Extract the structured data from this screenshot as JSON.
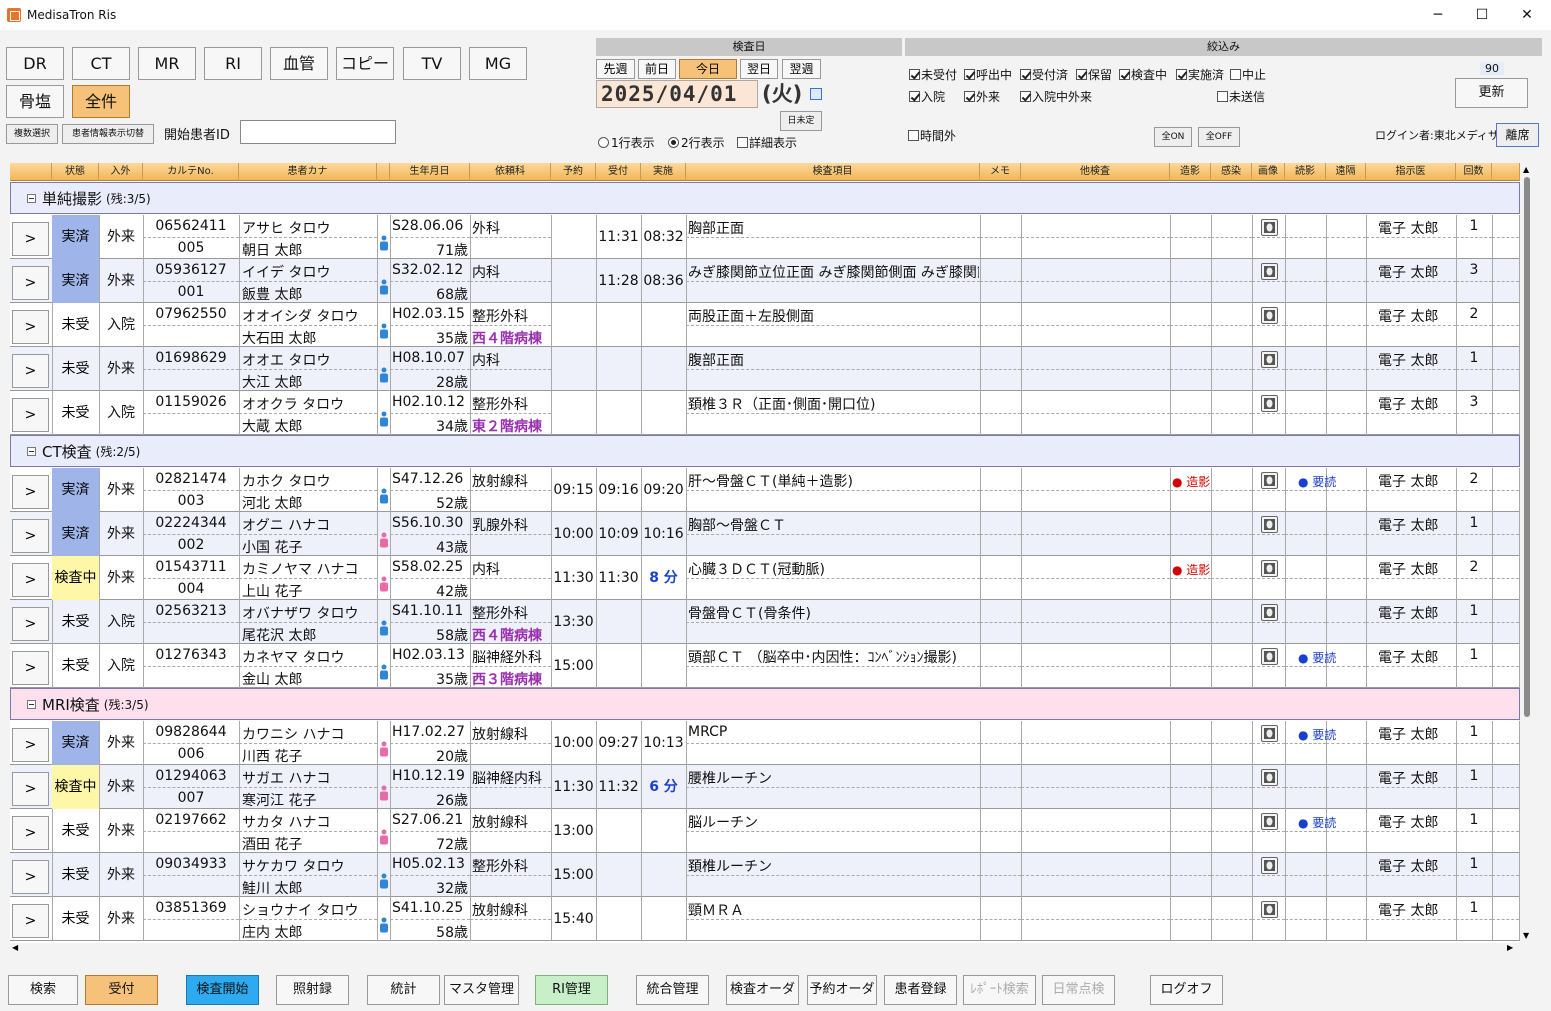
{
  "window": {
    "title": "MedisaTron Ris",
    "min": "─",
    "max": "☐",
    "close": "✕"
  },
  "modalities": [
    "DR",
    "CT",
    "MR",
    "RI",
    "血管",
    "コピー",
    "TV",
    "MG",
    "骨塩",
    "全件"
  ],
  "toolbar": {
    "multi_select": "複数選択",
    "patient_info_toggle": "患者情報表示切替",
    "start_patient_label": "開始患者ID",
    "start_patient_value": ""
  },
  "date": {
    "header": "検査日",
    "prev_week": "先週",
    "prev_day": "前日",
    "today": "今日",
    "next_day": "翌日",
    "next_week": "翌週",
    "value": "2025/04/01",
    "weekday": "(火)",
    "undetermined": "日未定",
    "display": {
      "one_line": "1行表示",
      "two_line": "2行表示",
      "detail": "詳細表示"
    }
  },
  "filter": {
    "header": "絞込み",
    "status": [
      {
        "label": "未受付",
        "on": true
      },
      {
        "label": "呼出中",
        "on": true
      },
      {
        "label": "受付済",
        "on": true
      },
      {
        "label": "保留",
        "on": true
      },
      {
        "label": "検査中",
        "on": true
      },
      {
        "label": "実施済",
        "on": true
      },
      {
        "label": "中止",
        "on": false
      }
    ],
    "types": [
      {
        "label": "入院",
        "on": true
      },
      {
        "label": "外来",
        "on": true
      },
      {
        "label": "入院中外来",
        "on": true
      }
    ],
    "unsent": {
      "label": "未送信",
      "on": false
    },
    "after_hours": {
      "label": "時間外",
      "on": false
    },
    "all_on": "全ON",
    "all_off": "全OFF",
    "count": "90",
    "refresh": "更新",
    "login": "ログイン者:東北メディサ",
    "leave": "離席"
  },
  "columns": [
    "状態",
    "入外",
    "カルテNo.",
    "患者カナ",
    "生年月日",
    "依頼科",
    "予約",
    "受付",
    "実施",
    "検査項目",
    "メモ",
    "他検査",
    "造影",
    "感染",
    "画像",
    "読影",
    "遠隔",
    "指示医",
    "回数"
  ],
  "groups": [
    {
      "title": "単純撮影",
      "remain": "(残:3/5)",
      "rows": [
        {
          "status": "実済",
          "type": "外来",
          "karte": "06562411",
          "sub": "005",
          "kana": "アサヒ タロウ",
          "name": "朝日 太郎",
          "sex": "M",
          "birth": "S28.06.06",
          "age": "71歳",
          "dept": "外科",
          "ward": "",
          "resv": "",
          "recv": "11:31",
          "done": "08:32",
          "item": "胸部正面",
          "contrast": "",
          "read": "",
          "doctor": "電子 太郎",
          "count": "1"
        },
        {
          "status": "実済",
          "type": "外来",
          "karte": "05936127",
          "sub": "001",
          "kana": "イイデ タロウ",
          "name": "飯豊 太郎",
          "sex": "M",
          "birth": "S32.02.12",
          "age": "68歳",
          "dept": "内科",
          "ward": "",
          "resv": "",
          "recv": "11:28",
          "done": "08:36",
          "item": "みぎ膝関節立位正面 みぎ膝関節側面 みぎ膝関節",
          "contrast": "",
          "read": "",
          "doctor": "電子 太郎",
          "count": "3"
        },
        {
          "status": "未受",
          "type": "入院",
          "karte": "07962550",
          "sub": "",
          "kana": "オオイシダ タロウ",
          "name": "大石田 太郎",
          "sex": "M",
          "birth": "H02.03.15",
          "age": "35歳",
          "dept": "整形外科",
          "ward": "西４階病棟",
          "resv": "",
          "recv": "",
          "done": "",
          "item": "両股正面＋左股側面",
          "contrast": "",
          "read": "",
          "doctor": "電子 太郎",
          "count": "2"
        },
        {
          "status": "未受",
          "type": "外来",
          "karte": "01698629",
          "sub": "",
          "kana": "オオエ タロウ",
          "name": "大江 太郎",
          "sex": "M",
          "birth": "H08.10.07",
          "age": "28歳",
          "dept": "内科",
          "ward": "",
          "resv": "",
          "recv": "",
          "done": "",
          "item": "腹部正面",
          "contrast": "",
          "read": "",
          "doctor": "電子 太郎",
          "count": "1"
        },
        {
          "status": "未受",
          "type": "入院",
          "karte": "01159026",
          "sub": "",
          "kana": "オオクラ タロウ",
          "name": "大蔵 太郎",
          "sex": "M",
          "birth": "H02.10.12",
          "age": "34歳",
          "dept": "整形外科",
          "ward": "東２階病棟",
          "resv": "",
          "recv": "",
          "done": "",
          "item": "頚椎３Ｒ（正面･側面･開口位)",
          "contrast": "",
          "read": "",
          "doctor": "電子 太郎",
          "count": "3"
        }
      ]
    },
    {
      "title": "CT検査",
      "remain": "(残:2/5)",
      "rows": [
        {
          "status": "実済",
          "type": "外来",
          "karte": "02821474",
          "sub": "003",
          "kana": "カホク タロウ",
          "name": "河北 太郎",
          "sex": "M",
          "birth": "S47.12.26",
          "age": "52歳",
          "dept": "放射線科",
          "ward": "",
          "resv": "09:15",
          "recv": "09:16",
          "done": "09:20",
          "item": "肝～骨盤ＣＴ(単純＋造影)",
          "contrast": "● 造影",
          "read": "● 要読",
          "doctor": "電子 太郎",
          "count": "2"
        },
        {
          "status": "実済",
          "type": "外来",
          "karte": "02224344",
          "sub": "002",
          "kana": "オグニ ハナコ",
          "name": "小国 花子",
          "sex": "F",
          "birth": "S56.10.30",
          "age": "43歳",
          "dept": "乳腺外科",
          "ward": "",
          "resv": "10:00",
          "recv": "10:09",
          "done": "10:16",
          "item": "胸部～骨盤ＣＴ",
          "contrast": "",
          "read": "",
          "doctor": "電子 太郎",
          "count": "1"
        },
        {
          "status": "検査中",
          "type": "外来",
          "karte": "01543711",
          "sub": "004",
          "kana": "カミノヤマ ハナコ",
          "name": "上山 花子",
          "sex": "F",
          "birth": "S58.02.25",
          "age": "42歳",
          "dept": "内科",
          "ward": "",
          "resv": "11:30",
          "recv": "11:30",
          "done": "8 分",
          "item": "心臓３ＤＣＴ(冠動脈)",
          "contrast": "● 造影",
          "read": "",
          "doctor": "電子 太郎",
          "count": "2"
        },
        {
          "status": "未受",
          "type": "入院",
          "karte": "02563213",
          "sub": "",
          "kana": "オバナザワ タロウ",
          "name": "尾花沢 太郎",
          "sex": "M",
          "birth": "S41.10.11",
          "age": "58歳",
          "dept": "整形外科",
          "ward": "西４階病棟",
          "resv": "13:30",
          "recv": "",
          "done": "",
          "item": "骨盤骨ＣＴ(骨条件)",
          "contrast": "",
          "read": "",
          "doctor": "電子 太郎",
          "count": "1"
        },
        {
          "status": "未受",
          "type": "入院",
          "karte": "01276343",
          "sub": "",
          "kana": "カネヤマ タロウ",
          "name": "金山 太郎",
          "sex": "M",
          "birth": "H02.03.13",
          "age": "35歳",
          "dept": "脳神経外科",
          "ward": "西３階病棟",
          "resv": "15:00",
          "recv": "",
          "done": "",
          "item": "頭部ＣＴ （脳卒中･内因性：ｺﾝﾍﾞﾝｼｮﾝ撮影)",
          "contrast": "",
          "read": "● 要読",
          "doctor": "電子 太郎",
          "count": "1"
        }
      ]
    },
    {
      "title": "MRI検査",
      "remain": "(残:3/5)",
      "rows": [
        {
          "status": "実済",
          "type": "外来",
          "karte": "09828644",
          "sub": "006",
          "kana": "カワニシ ハナコ",
          "name": "川西 花子",
          "sex": "F",
          "birth": "H17.02.27",
          "age": "20歳",
          "dept": "放射線科",
          "ward": "",
          "resv": "10:00",
          "recv": "09:27",
          "done": "10:13",
          "item": "MRCP",
          "contrast": "",
          "read": "● 要読",
          "doctor": "電子 太郎",
          "count": "1"
        },
        {
          "status": "検査中",
          "type": "外来",
          "karte": "01294063",
          "sub": "007",
          "kana": "サガエ ハナコ",
          "name": "寒河江 花子",
          "sex": "F",
          "birth": "H10.12.19",
          "age": "26歳",
          "dept": "脳神経内科",
          "ward": "",
          "resv": "11:30",
          "recv": "11:32",
          "done": "6 分",
          "item": "腰椎ルーチン",
          "contrast": "",
          "read": "",
          "doctor": "電子 太郎",
          "count": "1"
        },
        {
          "status": "未受",
          "type": "外来",
          "karte": "02197662",
          "sub": "",
          "kana": "サカタ ハナコ",
          "name": "酒田 花子",
          "sex": "F",
          "birth": "S27.06.21",
          "age": "72歳",
          "dept": "放射線科",
          "ward": "",
          "resv": "13:00",
          "recv": "",
          "done": "",
          "item": "脳ルーチン",
          "contrast": "",
          "read": "● 要読",
          "doctor": "電子 太郎",
          "count": "1"
        },
        {
          "status": "未受",
          "type": "外来",
          "karte": "09034933",
          "sub": "",
          "kana": "サケカワ タロウ",
          "name": "鮭川 太郎",
          "sex": "M",
          "birth": "H05.02.13",
          "age": "32歳",
          "dept": "整形外科",
          "ward": "",
          "resv": "15:00",
          "recv": "",
          "done": "",
          "item": "頚椎ルーチン",
          "contrast": "",
          "read": "",
          "doctor": "電子 太郎",
          "count": "1"
        },
        {
          "status": "未受",
          "type": "外来",
          "karte": "03851369",
          "sub": "",
          "kana": "ショウナイ タロウ",
          "name": "庄内 太郎",
          "sex": "M",
          "birth": "S41.10.25",
          "age": "58歳",
          "dept": "放射線科",
          "ward": "",
          "resv": "15:40",
          "recv": "",
          "done": "",
          "item": "頸ＭＲＡ",
          "contrast": "",
          "read": "",
          "doctor": "電子 太郎",
          "count": "1"
        }
      ]
    }
  ],
  "go_label": ">",
  "bottom": [
    "検索",
    "受付",
    "検査開始",
    "照射録",
    "統計",
    "マスタ管理",
    "RI管理",
    "統合管理",
    "検査オーダ",
    "予約オーダ",
    "患者登録",
    "ﾚﾎﾟｰﾄ検索",
    "日常点検",
    "ログオフ"
  ],
  "colors": {
    "accent": "#f6c27a",
    "done": "#9fb4e8",
    "in_progress": "#fff7a8",
    "mri_group": "#fde0ec",
    "group": "#e9ecfb"
  }
}
